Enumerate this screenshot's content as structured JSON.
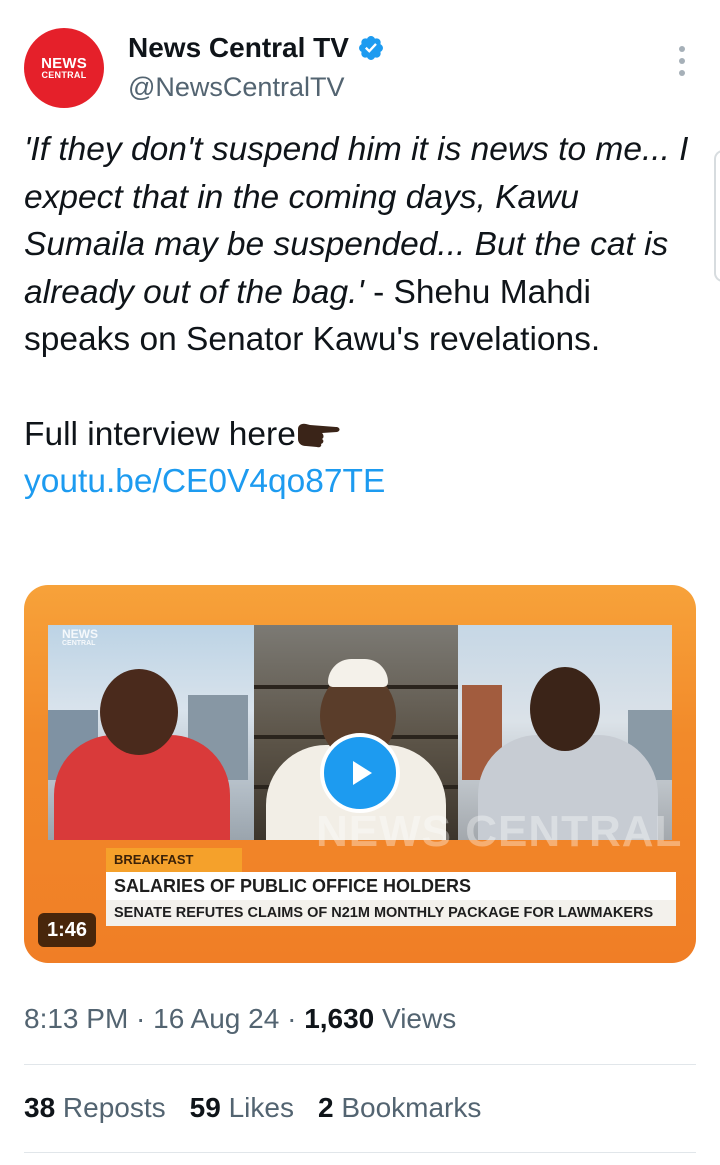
{
  "author": {
    "avatar_line1": "NEWS",
    "avatar_line2": "CENTRAL",
    "display_name": "News Central TV",
    "handle": "@NewsCentralTV",
    "verified_icon": "verified-badge-icon",
    "more_icon": "more-vertical-icon"
  },
  "tweet": {
    "quote_text": "'If they don't suspend him it is news to me... I expect that in the coming days, Kawu Sumaila may be suspended... But the cat is already out of the bag.'",
    "rest_text": " - Shehu Mahdi speaks on Senator Kawu's revelations.",
    "interview_prefix": "Full interview here",
    "pointing_icon": "pointing-right-emoji-icon",
    "link_text": "youtu.be/CE0V4qo87TE",
    "link_color": "#1d9bf0"
  },
  "media": {
    "logo_line1": "NEWS",
    "logo_line2": "CENTRAL",
    "watermark": "NEWS CENTRAL",
    "show_tag": "BREAKFAST CENTRAL",
    "headline": "SALARIES OF PUBLIC OFFICE HOLDERS",
    "subheadline": "SENATE REFUTES CLAIMS OF N21M MONTHLY PACKAGE FOR LAWMAKERS",
    "duration": "1:46",
    "play_icon": "play-icon",
    "accent": "#f28a2a"
  },
  "meta": {
    "time": "8:13 PM",
    "sep1": " · ",
    "date": "16 Aug 24",
    "sep2": " · ",
    "views_count": "1,630",
    "views_label": " Views"
  },
  "stats": {
    "reposts_count": "38",
    "reposts_label": " Reposts",
    "likes_count": "59",
    "likes_label": " Likes",
    "bookmarks_count": "2",
    "bookmarks_label": " Bookmarks"
  }
}
